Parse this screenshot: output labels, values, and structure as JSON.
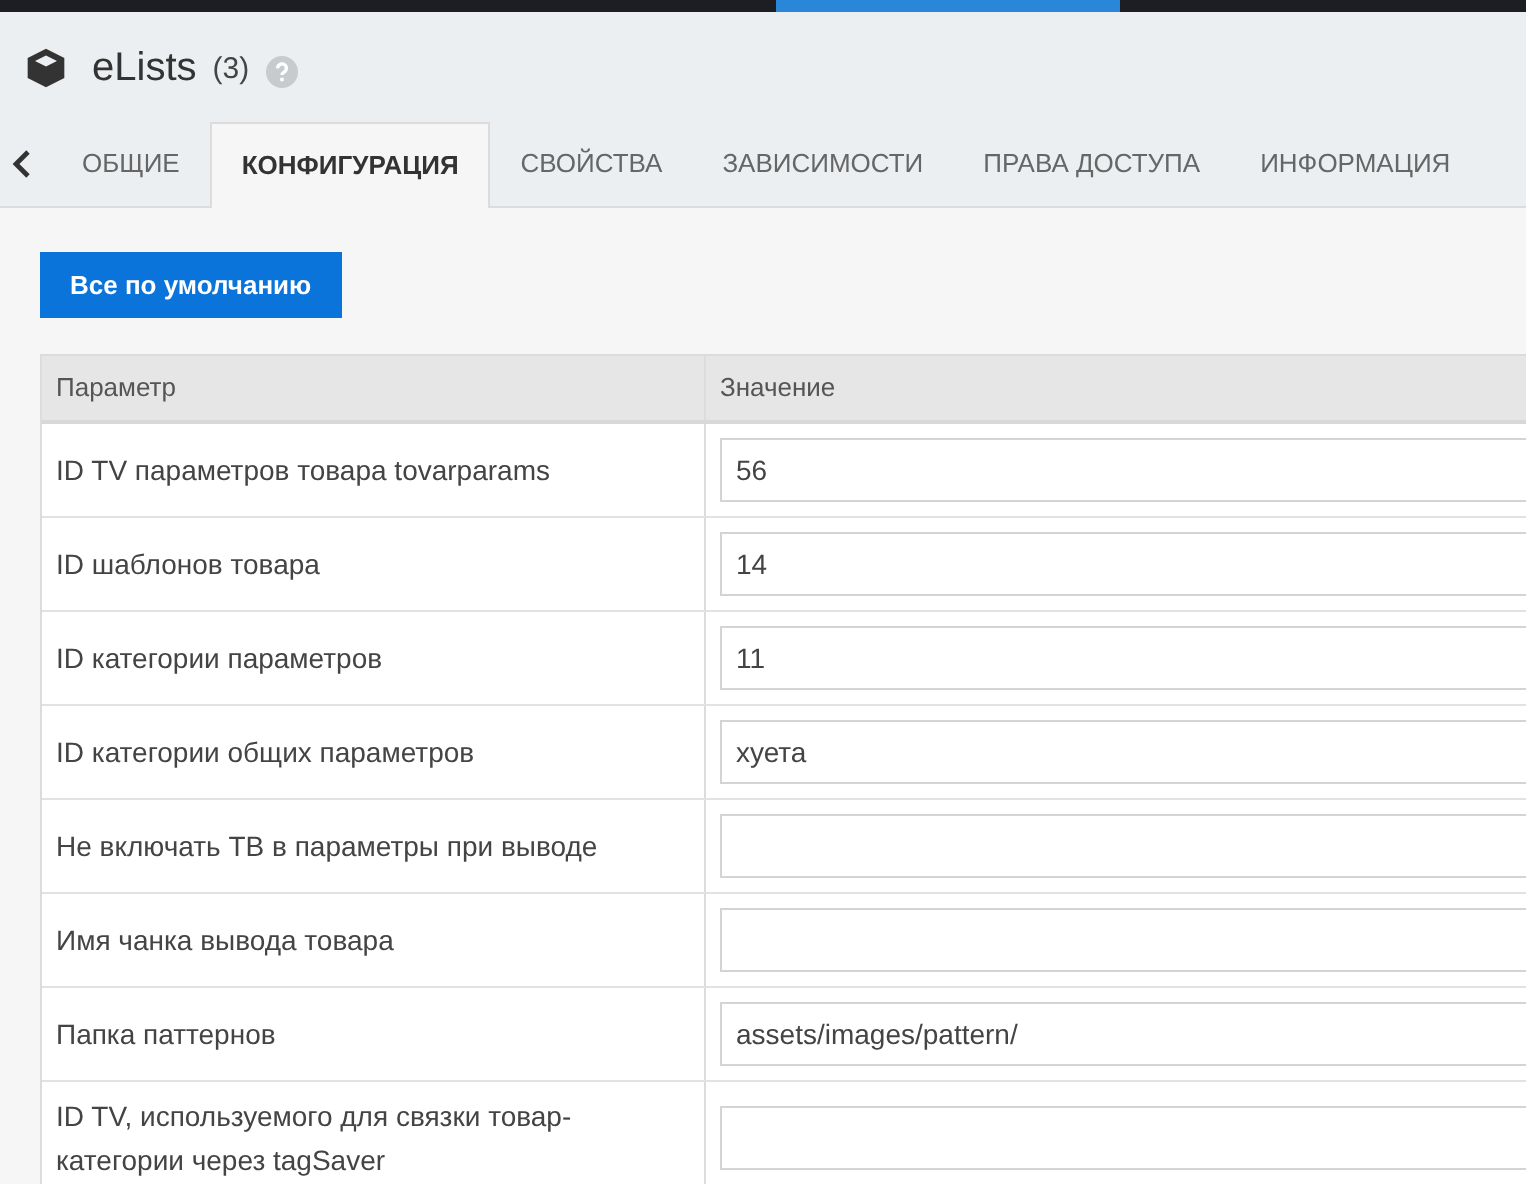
{
  "header": {
    "title": "eLists",
    "count": "(3)"
  },
  "tabs": [
    {
      "label": "ОБЩИЕ",
      "selected": false
    },
    {
      "label": "КОНФИГУРАЦИЯ",
      "selected": true
    },
    {
      "label": "СВОЙСТВА",
      "selected": false
    },
    {
      "label": "ЗАВИСИМОСТИ",
      "selected": false
    },
    {
      "label": "ПРАВА ДОСТУПА",
      "selected": false
    },
    {
      "label": "ИНФОРМАЦИЯ",
      "selected": false
    }
  ],
  "reset_button": "Все по умолчанию",
  "table": {
    "columns": [
      "Параметр",
      "Значение"
    ],
    "rows": [
      {
        "parameter": "ID TV параметров товара tovarparams",
        "value": "56"
      },
      {
        "parameter": "ID шаблонов товара",
        "value": "14"
      },
      {
        "parameter": "ID категории параметров",
        "value": "11"
      },
      {
        "parameter": "ID категории общих параметров",
        "value": "хуета"
      },
      {
        "parameter": "Не включать ТВ в параметры при выводе"
      },
      {
        "parameter": "Имя чанка вывода товара"
      },
      {
        "parameter": "Папка паттернов",
        "value": "assets/images/pattern/"
      },
      {
        "parameter": "ID TV, используемого для связки товар-категории через tagSaver"
      }
    ]
  }
}
